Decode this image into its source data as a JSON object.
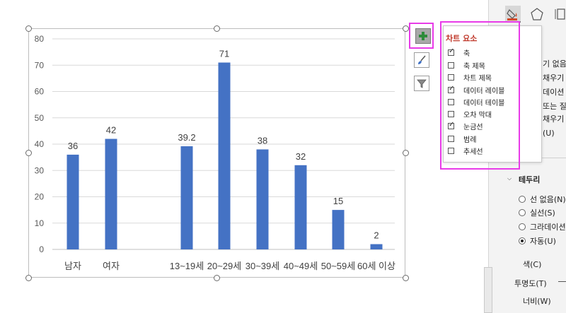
{
  "chart_data": {
    "type": "bar",
    "categories": [
      "남자",
      "여자",
      "13~19세",
      "20~29세",
      "30~39세",
      "40~49세",
      "50~59세",
      "60세 이상"
    ],
    "values": [
      36,
      42,
      39.2,
      71,
      38,
      32,
      15,
      2
    ],
    "data_labels": [
      "36",
      "42",
      "39.2",
      "71",
      "38",
      "32",
      "15",
      "2"
    ],
    "ylim": [
      0,
      80
    ],
    "yticks": [
      0,
      10,
      20,
      30,
      40,
      50,
      60,
      70,
      80
    ],
    "ytick_labels": [
      "0",
      "10",
      "20",
      "30",
      "40",
      "50",
      "60",
      "70",
      "80"
    ],
    "grid": true,
    "bar_color": "#4472c4",
    "title": "",
    "xlabel": "",
    "ylabel": ""
  },
  "chart_elements_panel": {
    "title": "차트 요소",
    "items": [
      {
        "label": "축",
        "checked": true
      },
      {
        "label": "축 제목",
        "checked": false
      },
      {
        "label": "차트 제목",
        "checked": false
      },
      {
        "label": "데이터 레이블",
        "checked": true
      },
      {
        "label": "데이터 테이블",
        "checked": false
      },
      {
        "label": "오차 막대",
        "checked": false
      },
      {
        "label": "눈금선",
        "checked": true
      },
      {
        "label": "범례",
        "checked": false
      },
      {
        "label": "추세선",
        "checked": false
      }
    ]
  },
  "side_buttons": {
    "elements_icon": "plus-icon",
    "styles_icon": "brush-icon",
    "filter_icon": "filter-icon"
  },
  "format_pane": {
    "fill_lines": [
      "기 없음",
      "채우기",
      "데이션",
      "또는 질",
      "채우기",
      "(U)"
    ],
    "border_header": "테두리",
    "border_options": [
      {
        "label": "선 없음(N)",
        "selected": false
      },
      {
        "label": "실선(S)",
        "selected": false
      },
      {
        "label": "그라데이션",
        "selected": false
      },
      {
        "label": "자동(U)",
        "selected": true
      }
    ],
    "color_label": "색(C)",
    "transparency_label": "투명도(T)",
    "width_label": "너비(W)"
  },
  "colors": {
    "highlight": "#e83be8",
    "panel_title": "#c0392b",
    "gridline": "#d9d9d9"
  }
}
